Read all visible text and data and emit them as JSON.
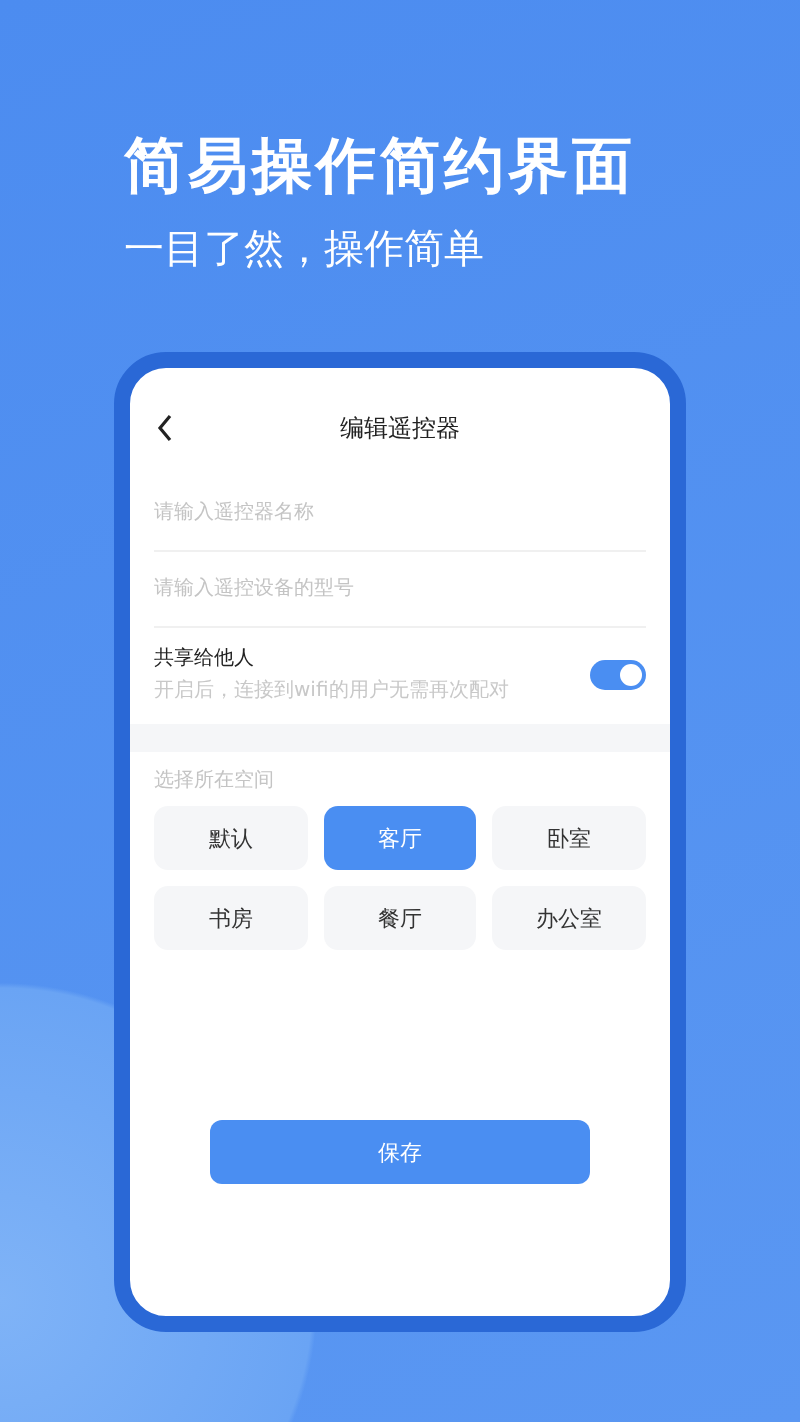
{
  "headline": "简易操作简约界面",
  "subtitle": "一目了然，操作简单",
  "phone": {
    "title": "编辑遥控器",
    "fields": [
      {
        "placeholder": "请输入遥控器名称"
      },
      {
        "placeholder": "请输入遥控设备的型号"
      }
    ],
    "share": {
      "label": "共享给他人",
      "hint": "开启后，连接到wifi的用户无需再次配对",
      "on": true
    },
    "rooms_label": "选择所在空间",
    "rooms": [
      {
        "label": "默认",
        "selected": false
      },
      {
        "label": "客厅",
        "selected": true
      },
      {
        "label": "卧室",
        "selected": false
      },
      {
        "label": "书房",
        "selected": false
      },
      {
        "label": "餐厅",
        "selected": false
      },
      {
        "label": "办公室",
        "selected": false
      }
    ],
    "save": "保存"
  }
}
